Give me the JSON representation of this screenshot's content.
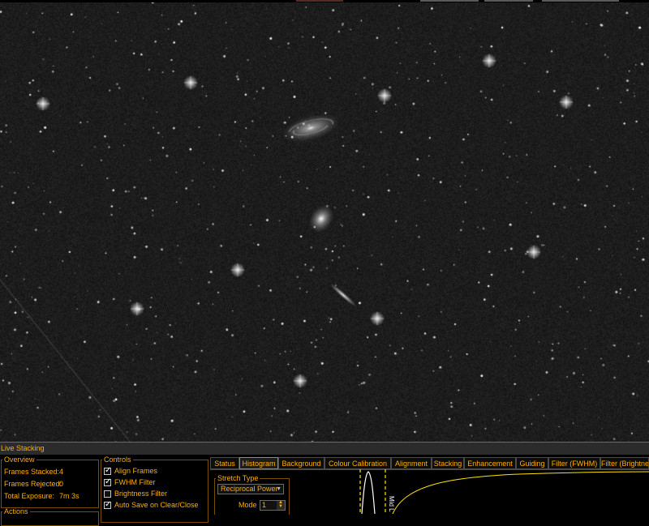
{
  "panel_title": "Live Stacking",
  "overview": {
    "legend": "Overview",
    "frames_stacked_label": "Frames Stacked:",
    "frames_stacked_value": "4",
    "frames_rejected_label": "Frames Rejected:",
    "frames_rejected_value": "0",
    "total_exposure_label": "Total Exposure:",
    "total_exposure_value": "7m 3s"
  },
  "actions": {
    "legend": "Actions"
  },
  "controls": {
    "legend": "Controls",
    "items": [
      {
        "label": "Align Frames",
        "checked": true
      },
      {
        "label": "FWHM Filter",
        "checked": true
      },
      {
        "label": "Brightness Filter",
        "checked": false
      },
      {
        "label": "Auto Save on Clear/Close",
        "checked": true
      }
    ]
  },
  "tabs": [
    "Status",
    "Histogram",
    "Background",
    "Colour Calibration",
    "Alignment",
    "Stacking",
    "Enhancement",
    "Guiding",
    "Filter (FWHM)",
    "Filter (Brightness)"
  ],
  "active_tab": "Histogram",
  "histogram": {
    "stretch_type_legend": "Stretch Type",
    "stretch_type_value": "Reciprocal Power",
    "mode_label": "Mode",
    "mode_value": "1",
    "mid_label": "Mid L"
  },
  "colors": {
    "accent": "#ffb000",
    "background": "#000000",
    "panel": "#2b2b2b"
  },
  "icons": {
    "dropdown": "chevron-down-icon",
    "spinner": "spinner-arrows-icon"
  }
}
